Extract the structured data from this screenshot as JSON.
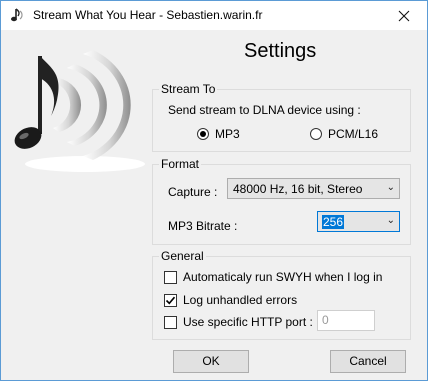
{
  "window": {
    "title": "Stream What You Hear - Sebastien.warin.fr",
    "close_glyph": "✕"
  },
  "heading": "Settings",
  "stream_to": {
    "legend": "Stream To",
    "description": "Send stream to DLNA device using :",
    "options": [
      {
        "label": "MP3",
        "selected": true
      },
      {
        "label": "PCM/L16",
        "selected": false
      }
    ]
  },
  "format": {
    "legend": "Format",
    "capture_label": "Capture :",
    "capture_value": "48000 Hz, 16 bit, Stereo",
    "bitrate_label": "MP3 Bitrate :",
    "bitrate_value": "256"
  },
  "general": {
    "legend": "General",
    "autorun": {
      "label": "Automaticaly run SWYH when I log in",
      "checked": false
    },
    "log_errors": {
      "label": "Log unhandled errors",
      "checked": true
    },
    "http_port": {
      "label": "Use specific HTTP port :",
      "checked": false,
      "value": "0"
    }
  },
  "buttons": {
    "ok": "OK",
    "cancel": "Cancel"
  },
  "icons": {
    "app": "music-note-icon",
    "close": "close-icon",
    "logo": "music-note-sound-waves-logo",
    "dropdown": "chevron-down-icon",
    "check": "checkmark-icon"
  }
}
